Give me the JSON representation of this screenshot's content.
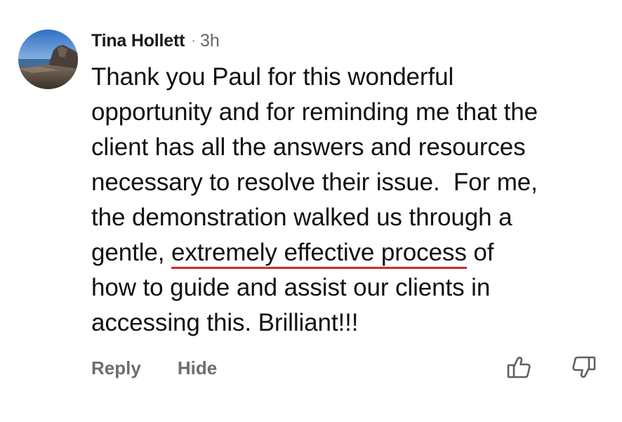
{
  "comment": {
    "author": "Tina Hollett",
    "separator": "·",
    "timestamp": "3h",
    "avatar_icon": "beach-landscape-avatar",
    "body_lines": [
      "Thank you Paul for this wonderful",
      "opportunity and for reminding me that the",
      "client has all the answers and resources",
      "necessary to resolve their issue.  For me,",
      "the demonstration walked us through a"
    ],
    "highlight_line": {
      "before": "gentle, ",
      "highlighted": "extremely effective process",
      "after": " of"
    },
    "body_lines_after": [
      "how to guide and assist our clients in",
      "accessing this. Brilliant!!!"
    ],
    "highlight_color": "#d8252b"
  },
  "actions": {
    "reply_label": "Reply",
    "hide_label": "Hide",
    "upvote_icon": "thumbs-up-icon",
    "downvote_icon": "thumbs-down-icon"
  }
}
